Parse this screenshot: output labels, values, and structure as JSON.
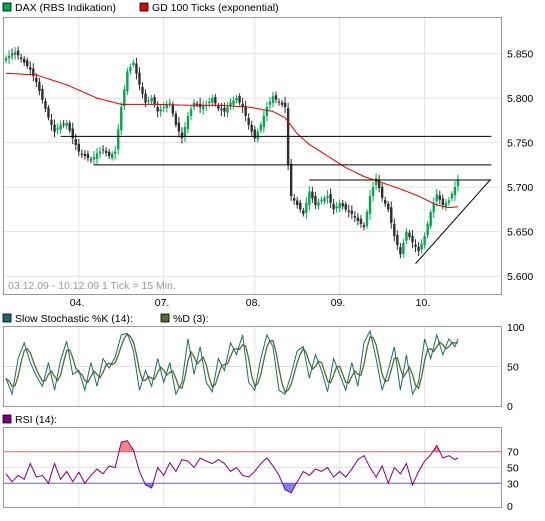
{
  "chart_data": [
    {
      "type": "candlestick",
      "legend": [
        {
          "label": "DAX (RBS Indikation)",
          "color": "#00a651"
        },
        {
          "label": "GD 100 Ticks (exponential)",
          "color": "#e00000"
        }
      ],
      "date_range_text": "03.12.09 - 10.12.09  1 Tick = 15 Min.",
      "x_ticks": [
        "04.",
        "07.",
        "08.",
        "09.",
        "10."
      ],
      "y_ticks": [
        "5.850",
        "5.800",
        "5.750",
        "5.700",
        "5.650",
        "5.600"
      ],
      "ylim": [
        5580,
        5890
      ],
      "x_count": 150,
      "tick_index": [
        24,
        52,
        82,
        110,
        138
      ],
      "close_anchors": [
        [
          0,
          5845
        ],
        [
          3,
          5852
        ],
        [
          6,
          5840
        ],
        [
          8,
          5832
        ],
        [
          10,
          5818
        ],
        [
          12,
          5798
        ],
        [
          14,
          5778
        ],
        [
          16,
          5762
        ],
        [
          18,
          5770
        ],
        [
          20,
          5772
        ],
        [
          22,
          5755
        ],
        [
          24,
          5740
        ],
        [
          26,
          5735
        ],
        [
          28,
          5730
        ],
        [
          30,
          5738
        ],
        [
          32,
          5742
        ],
        [
          34,
          5735
        ],
        [
          36,
          5740
        ],
        [
          38,
          5790
        ],
        [
          40,
          5830
        ],
        [
          42,
          5840
        ],
        [
          44,
          5815
        ],
        [
          46,
          5795
        ],
        [
          48,
          5800
        ],
        [
          50,
          5785
        ],
        [
          52,
          5790
        ],
        [
          54,
          5795
        ],
        [
          56,
          5770
        ],
        [
          58,
          5755
        ],
        [
          60,
          5780
        ],
        [
          62,
          5795
        ],
        [
          64,
          5790
        ],
        [
          66,
          5792
        ],
        [
          68,
          5800
        ],
        [
          70,
          5788
        ],
        [
          72,
          5785
        ],
        [
          74,
          5795
        ],
        [
          76,
          5800
        ],
        [
          78,
          5790
        ],
        [
          80,
          5770
        ],
        [
          82,
          5755
        ],
        [
          84,
          5770
        ],
        [
          86,
          5790
        ],
        [
          88,
          5802
        ],
        [
          90,
          5795
        ],
        [
          92,
          5790
        ],
        [
          93,
          5725
        ],
        [
          94,
          5690
        ],
        [
          96,
          5680
        ],
        [
          98,
          5670
        ],
        [
          100,
          5695
        ],
        [
          102,
          5680
        ],
        [
          104,
          5686
        ],
        [
          106,
          5690
        ],
        [
          108,
          5675
        ],
        [
          110,
          5682
        ],
        [
          112,
          5675
        ],
        [
          114,
          5670
        ],
        [
          116,
          5662
        ],
        [
          118,
          5655
        ],
        [
          120,
          5690
        ],
        [
          122,
          5710
        ],
        [
          124,
          5688
        ],
        [
          126,
          5675
        ],
        [
          128,
          5645
        ],
        [
          130,
          5625
        ],
        [
          132,
          5650
        ],
        [
          134,
          5638
        ],
        [
          136,
          5628
        ],
        [
          138,
          5645
        ],
        [
          140,
          5672
        ],
        [
          142,
          5692
        ],
        [
          144,
          5680
        ],
        [
          146,
          5685
        ],
        [
          148,
          5700
        ],
        [
          149,
          5708
        ]
      ],
      "ema_anchors": [
        [
          0,
          5828
        ],
        [
          10,
          5826
        ],
        [
          20,
          5815
        ],
        [
          30,
          5800
        ],
        [
          38,
          5793
        ],
        [
          50,
          5793
        ],
        [
          60,
          5792
        ],
        [
          70,
          5792
        ],
        [
          80,
          5790
        ],
        [
          88,
          5785
        ],
        [
          92,
          5778
        ],
        [
          96,
          5760
        ],
        [
          100,
          5748
        ],
        [
          106,
          5735
        ],
        [
          112,
          5722
        ],
        [
          118,
          5712
        ],
        [
          124,
          5705
        ],
        [
          130,
          5698
        ],
        [
          136,
          5690
        ],
        [
          142,
          5680
        ],
        [
          146,
          5677
        ],
        [
          149,
          5678
        ]
      ],
      "lines": [
        {
          "kind": "horizontal",
          "x1": 18,
          "x2": 160,
          "y": 5757
        },
        {
          "kind": "horizontal",
          "x1": 29,
          "x2": 160,
          "y": 5725
        },
        {
          "kind": "horizontal",
          "x1": 100,
          "x2": 160,
          "y": 5708
        },
        {
          "kind": "trend",
          "from": [
            135,
            5614
          ],
          "to": [
            160,
            5708
          ]
        }
      ]
    },
    {
      "type": "line",
      "legend": [
        {
          "label": "Slow Stochastic %K (14):",
          "color": "#1e6b6b"
        },
        {
          "label": "%D (3):",
          "color": "#556b2f"
        }
      ],
      "y_ticks": [
        "100",
        "50",
        "0"
      ],
      "ylim": [
        0,
        100
      ],
      "k_anchors": [
        [
          0,
          35
        ],
        [
          2,
          15
        ],
        [
          4,
          60
        ],
        [
          6,
          80
        ],
        [
          8,
          55
        ],
        [
          10,
          38
        ],
        [
          12,
          25
        ],
        [
          14,
          55
        ],
        [
          16,
          20
        ],
        [
          18,
          58
        ],
        [
          20,
          82
        ],
        [
          22,
          40
        ],
        [
          24,
          45
        ],
        [
          26,
          20
        ],
        [
          28,
          55
        ],
        [
          30,
          25
        ],
        [
          32,
          60
        ],
        [
          34,
          48
        ],
        [
          36,
          62
        ],
        [
          38,
          90
        ],
        [
          40,
          92
        ],
        [
          42,
          70
        ],
        [
          44,
          20
        ],
        [
          46,
          45
        ],
        [
          48,
          25
        ],
        [
          50,
          60
        ],
        [
          52,
          30
        ],
        [
          54,
          55
        ],
        [
          56,
          15
        ],
        [
          58,
          30
        ],
        [
          60,
          85
        ],
        [
          62,
          40
        ],
        [
          64,
          75
        ],
        [
          66,
          30
        ],
        [
          68,
          18
        ],
        [
          70,
          60
        ],
        [
          72,
          45
        ],
        [
          74,
          80
        ],
        [
          76,
          65
        ],
        [
          78,
          90
        ],
        [
          80,
          30
        ],
        [
          82,
          20
        ],
        [
          84,
          60
        ],
        [
          86,
          90
        ],
        [
          88,
          75
        ],
        [
          90,
          20
        ],
        [
          92,
          15
        ],
        [
          94,
          40
        ],
        [
          96,
          70
        ],
        [
          98,
          75
        ],
        [
          100,
          35
        ],
        [
          102,
          65
        ],
        [
          104,
          45
        ],
        [
          106,
          18
        ],
        [
          108,
          60
        ],
        [
          110,
          40
        ],
        [
          112,
          20
        ],
        [
          114,
          55
        ],
        [
          116,
          25
        ],
        [
          118,
          80
        ],
        [
          120,
          95
        ],
        [
          122,
          60
        ],
        [
          124,
          20
        ],
        [
          126,
          45
        ],
        [
          128,
          75
        ],
        [
          130,
          20
        ],
        [
          132,
          65
        ],
        [
          134,
          15
        ],
        [
          136,
          30
        ],
        [
          138,
          85
        ],
        [
          140,
          60
        ],
        [
          142,
          90
        ],
        [
          144,
          65
        ],
        [
          146,
          85
        ],
        [
          148,
          75
        ],
        [
          149,
          85
        ]
      ]
    },
    {
      "type": "line",
      "legend": [
        {
          "label": "RSI (14):",
          "color": "#800080"
        }
      ],
      "y_ticks": [
        "70",
        "50",
        "30",
        "0"
      ],
      "ylim": [
        0,
        100
      ],
      "levels": [
        70,
        30
      ],
      "rsi_anchors": [
        [
          0,
          42
        ],
        [
          2,
          32
        ],
        [
          4,
          40
        ],
        [
          6,
          35
        ],
        [
          8,
          55
        ],
        [
          10,
          38
        ],
        [
          12,
          40
        ],
        [
          14,
          30
        ],
        [
          16,
          55
        ],
        [
          18,
          35
        ],
        [
          20,
          45
        ],
        [
          22,
          32
        ],
        [
          24,
          44
        ],
        [
          26,
          30
        ],
        [
          28,
          40
        ],
        [
          30,
          48
        ],
        [
          32,
          42
        ],
        [
          34,
          52
        ],
        [
          36,
          50
        ],
        [
          38,
          82
        ],
        [
          40,
          84
        ],
        [
          42,
          72
        ],
        [
          44,
          45
        ],
        [
          46,
          28
        ],
        [
          48,
          24
        ],
        [
          50,
          50
        ],
        [
          52,
          40
        ],
        [
          54,
          56
        ],
        [
          56,
          45
        ],
        [
          58,
          60
        ],
        [
          60,
          58
        ],
        [
          62,
          50
        ],
        [
          64,
          62
        ],
        [
          66,
          58
        ],
        [
          68,
          55
        ],
        [
          70,
          60
        ],
        [
          72,
          55
        ],
        [
          74,
          45
        ],
        [
          76,
          50
        ],
        [
          78,
          40
        ],
        [
          80,
          38
        ],
        [
          82,
          45
        ],
        [
          84,
          55
        ],
        [
          86,
          62
        ],
        [
          88,
          52
        ],
        [
          90,
          40
        ],
        [
          92,
          22
        ],
        [
          94,
          18
        ],
        [
          96,
          32
        ],
        [
          98,
          45
        ],
        [
          100,
          40
        ],
        [
          102,
          48
        ],
        [
          104,
          45
        ],
        [
          106,
          50
        ],
        [
          108,
          38
        ],
        [
          110,
          45
        ],
        [
          112,
          38
        ],
        [
          114,
          48
        ],
        [
          116,
          60
        ],
        [
          118,
          65
        ],
        [
          120,
          50
        ],
        [
          122,
          38
        ],
        [
          124,
          52
        ],
        [
          126,
          30
        ],
        [
          128,
          50
        ],
        [
          130,
          42
        ],
        [
          132,
          55
        ],
        [
          134,
          28
        ],
        [
          136,
          45
        ],
        [
          138,
          58
        ],
        [
          140,
          66
        ],
        [
          142,
          78
        ],
        [
          144,
          62
        ],
        [
          146,
          65
        ],
        [
          148,
          60
        ],
        [
          149,
          62
        ]
      ]
    }
  ]
}
